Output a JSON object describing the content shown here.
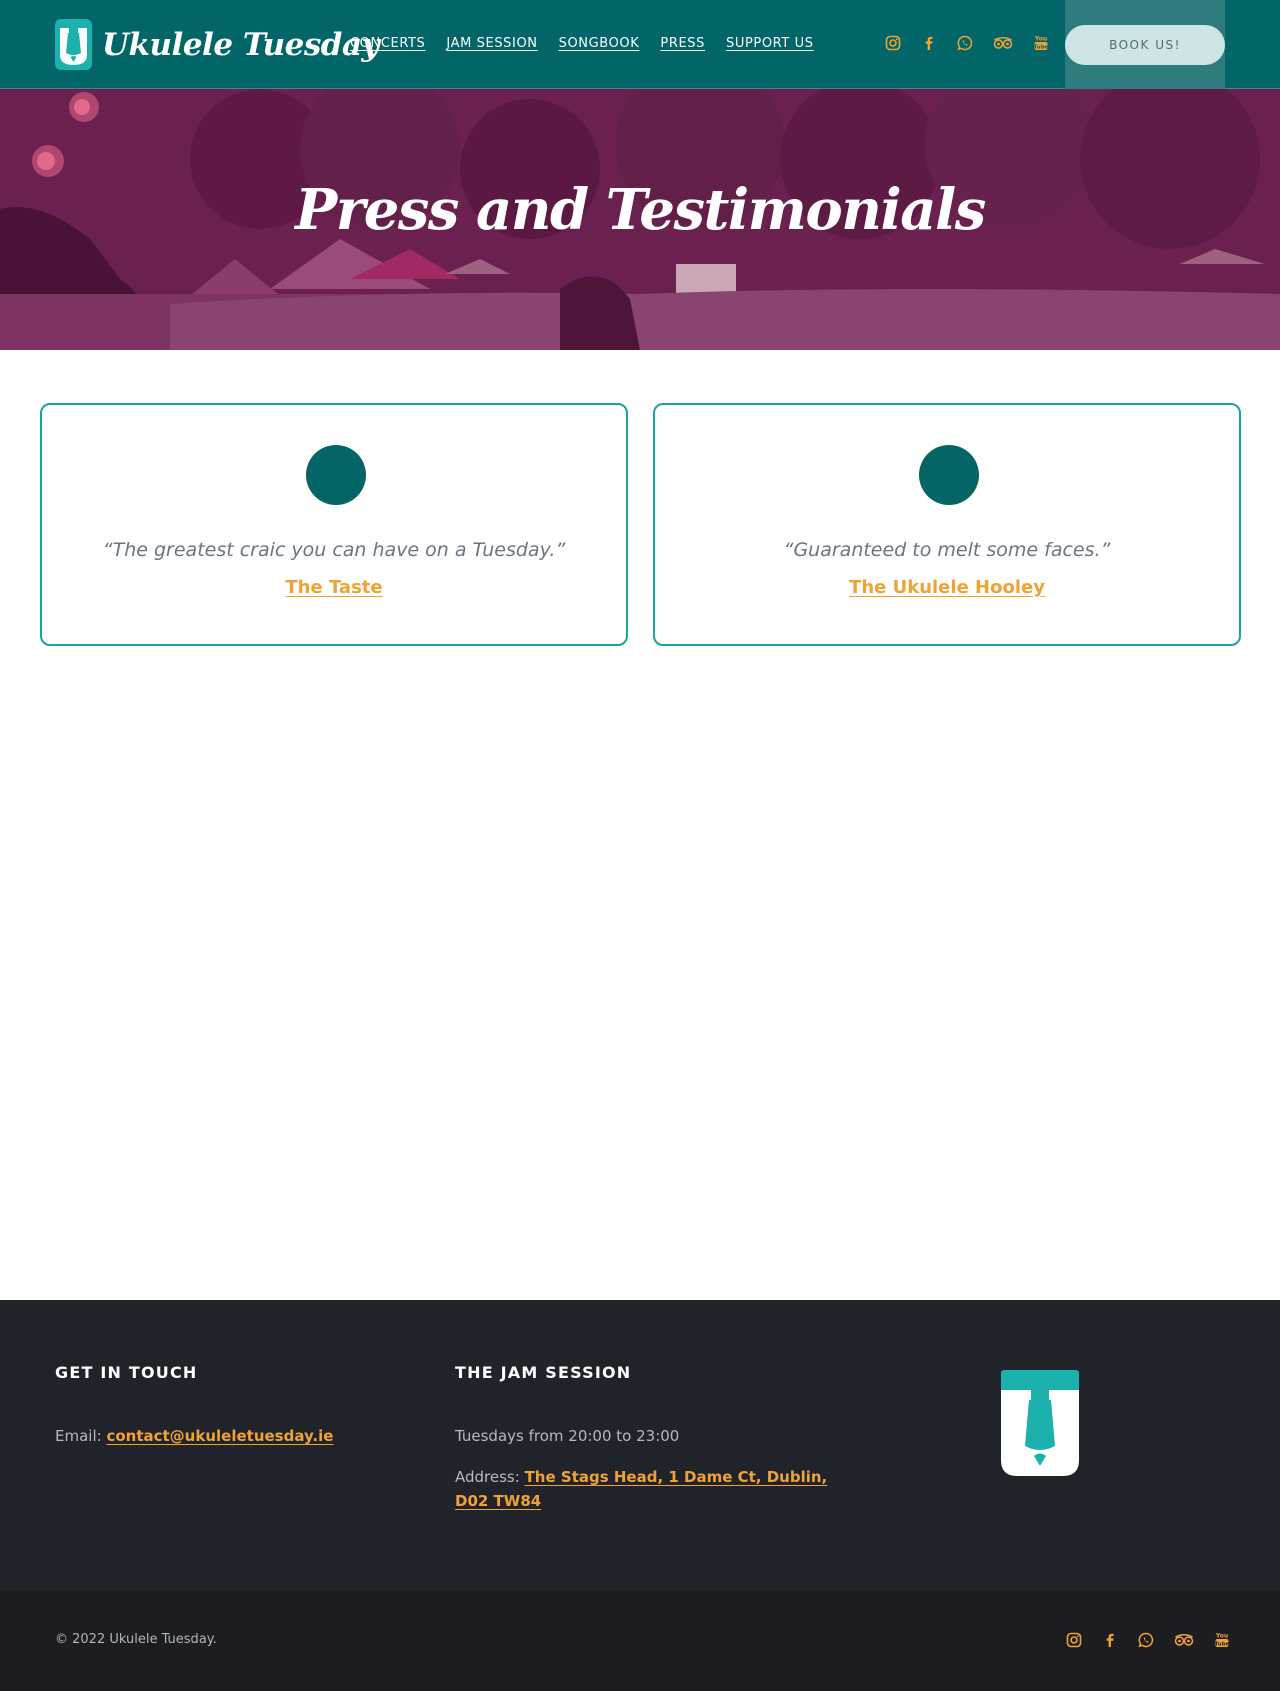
{
  "site": {
    "name": "Ukulele Tuesday",
    "colors": {
      "teal": "#026669",
      "accent": "#f1a235",
      "hero_overlay": "#6a1f4c",
      "footer": "#21232b"
    }
  },
  "nav": {
    "items": [
      {
        "label": "CONCERTS"
      },
      {
        "label": "JAM SESSION"
      },
      {
        "label": "SONGBOOK"
      },
      {
        "label": "PRESS"
      },
      {
        "label": "SUPPORT US"
      }
    ]
  },
  "social": {
    "icons": [
      "instagram-icon",
      "facebook-icon",
      "whatsapp-icon",
      "tripadvisor-icon",
      "youtube-icon"
    ]
  },
  "header": {
    "book_label": "BOOK US!"
  },
  "hero": {
    "title": "Press and Testimonials"
  },
  "testimonials": [
    {
      "quote": "“The greatest craic you can have on a Tuesday.”",
      "source": "The Taste"
    },
    {
      "quote": "“Guaranteed to melt some faces.”",
      "source": "The Ukulele Hooley"
    }
  ],
  "footer": {
    "contact": {
      "heading": "GET IN TOUCH",
      "email_label": "Email:",
      "email": "contact@ukuleletuesday.ie"
    },
    "jam": {
      "heading": "THE JAM SESSION",
      "schedule": "Tuesdays from 20:00 to 23:00",
      "address_label": "Address:",
      "address_line1": "The Stags Head, 1 Dame Ct, Dublin,",
      "address_line2": "D02 TW84"
    },
    "copyright": "© 2022 Ukulele Tuesday."
  }
}
